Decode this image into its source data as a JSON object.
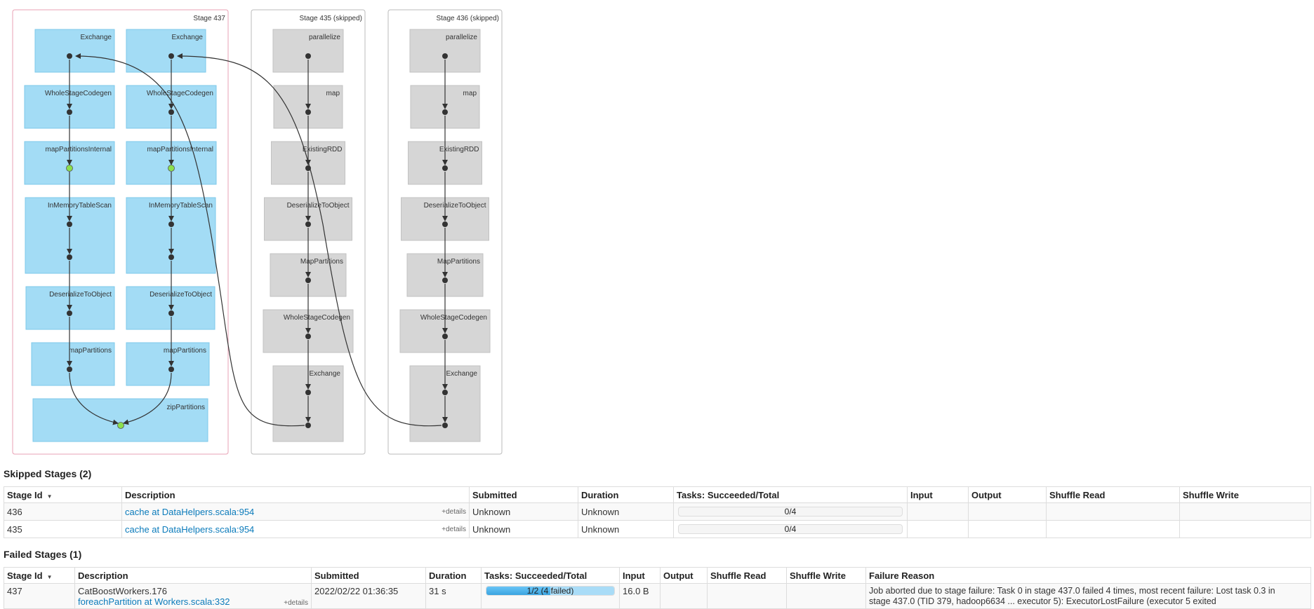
{
  "dag": {
    "clusters": [
      {
        "label": "Stage 437"
      },
      {
        "label": "Stage 435 (skipped)"
      },
      {
        "label": "Stage 436 (skipped)"
      }
    ],
    "stage437_left": [
      "Exchange",
      "WholeStageCodegen",
      "mapPartitionsInternal",
      "InMemoryTableScan",
      "DeserializeToObject",
      "mapPartitions"
    ],
    "stage437_right": [
      "Exchange",
      "WholeStageCodegen",
      "mapPartitionsInternal",
      "InMemoryTableScan",
      "DeserializeToObject",
      "mapPartitions"
    ],
    "stage437_bottom": "zipPartitions",
    "skipped_chain": [
      "parallelize",
      "map",
      "ExistingRDD",
      "DeserializeToObject",
      "MapPartitions",
      "WholeStageCodegen",
      "Exchange"
    ],
    "colors": {
      "stage_border": "#e8a0b4",
      "skipped_border": "#bbbbbb",
      "active_node": "#a3dcf5",
      "active_node_border": "#7ec8ea",
      "skipped_node": "#d6d6d6",
      "cached_dot": "#8be04e",
      "edge": "#333333"
    }
  },
  "skipped": {
    "title": "Skipped Stages (2)",
    "headers": [
      "Stage Id",
      "Description",
      "Submitted",
      "Duration",
      "Tasks: Succeeded/Total",
      "Input",
      "Output",
      "Shuffle Read",
      "Shuffle Write"
    ],
    "rows": [
      {
        "id": "436",
        "desc": "cache at DataHelpers.scala:954",
        "details": "+details",
        "submitted": "Unknown",
        "duration": "Unknown",
        "tasks": "0/4"
      },
      {
        "id": "435",
        "desc": "cache at DataHelpers.scala:954",
        "details": "+details",
        "submitted": "Unknown",
        "duration": "Unknown",
        "tasks": "0/4"
      }
    ]
  },
  "failed": {
    "title": "Failed Stages (1)",
    "headers": [
      "Stage Id",
      "Description",
      "Submitted",
      "Duration",
      "Tasks: Succeeded/Total",
      "Input",
      "Output",
      "Shuffle Read",
      "Shuffle Write",
      "Failure Reason"
    ],
    "rows": [
      {
        "id": "437",
        "desc_line1": "CatBoostWorkers.176",
        "desc_line2": "foreachPartition at Workers.scala:332",
        "details": "+details",
        "submitted": "2022/02/22 01:36:35",
        "duration": "31 s",
        "tasks": "1/2 (4 failed)",
        "tasks_succeeded_fraction": 0.5,
        "input": "16.0 B",
        "reason_line1": "Job aborted due to stage failure: Task 0 in stage 437.0 failed 4 times, most recent failure: Lost task 0.3 in",
        "reason_line2": "stage 437.0 (TID 379, hadoop6634 ... executor 5): ExecutorLostFailure (executor 5 exited"
      }
    ]
  }
}
